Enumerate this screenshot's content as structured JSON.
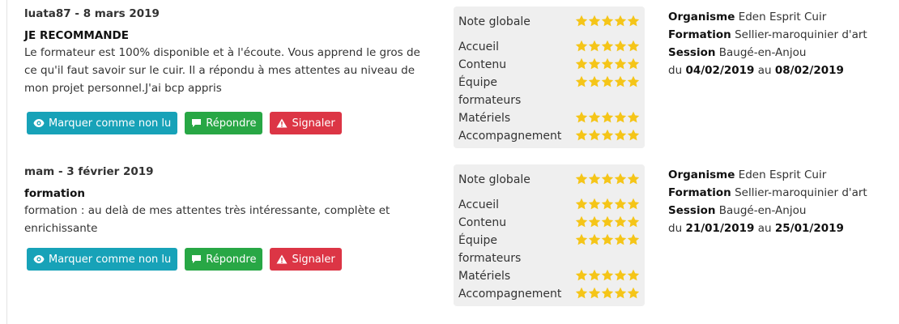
{
  "colors": {
    "info": "#17a2b8",
    "success": "#28a745",
    "danger": "#dc3545",
    "star": "#f5c518"
  },
  "buttons": {
    "mark_unread": "Marquer comme non lu",
    "reply": "Répondre",
    "report": "Signaler"
  },
  "info_labels": {
    "organisme": "Organisme",
    "formation": "Formation",
    "session": "Session",
    "du": "du",
    "au": "au"
  },
  "rating_labels": {
    "global": "Note globale",
    "accueil": "Accueil",
    "contenu": "Contenu",
    "equipe": "Équipe formateurs",
    "materiels": "Matériels",
    "accompagnement": "Accompagnement"
  },
  "reviews": [
    {
      "meta": "luata87 - 8 mars 2019",
      "title": "JE RECOMMANDE",
      "body": "Le formateur est 100% disponible et à l'écoute. Vous apprend le gros de ce qu'il faut savoir sur le cuir. Il a répondu à mes attentes au niveau de mon projet personnel.J'ai bcp appris",
      "ratings": {
        "global": 5,
        "accueil": 5,
        "contenu": 5,
        "equipe": 5,
        "materiels": 5,
        "accompagnement": 5
      },
      "organisme": "Eden Esprit Cuir",
      "formation": "Sellier-maroquinier d'art",
      "session": "Baugé-en-Anjou",
      "date_from": "04/02/2019",
      "date_to": "08/02/2019"
    },
    {
      "meta": "mam - 3 février 2019",
      "title": "formation",
      "body": "formation : au delà de mes attentes très intéressante, complète et enrichissante",
      "ratings": {
        "global": 5,
        "accueil": 5,
        "contenu": 5,
        "equipe": 5,
        "materiels": 5,
        "accompagnement": 5
      },
      "organisme": "Eden Esprit Cuir",
      "formation": "Sellier-maroquinier d'art",
      "session": "Baugé-en-Anjou",
      "date_from": "21/01/2019",
      "date_to": "25/01/2019"
    }
  ]
}
